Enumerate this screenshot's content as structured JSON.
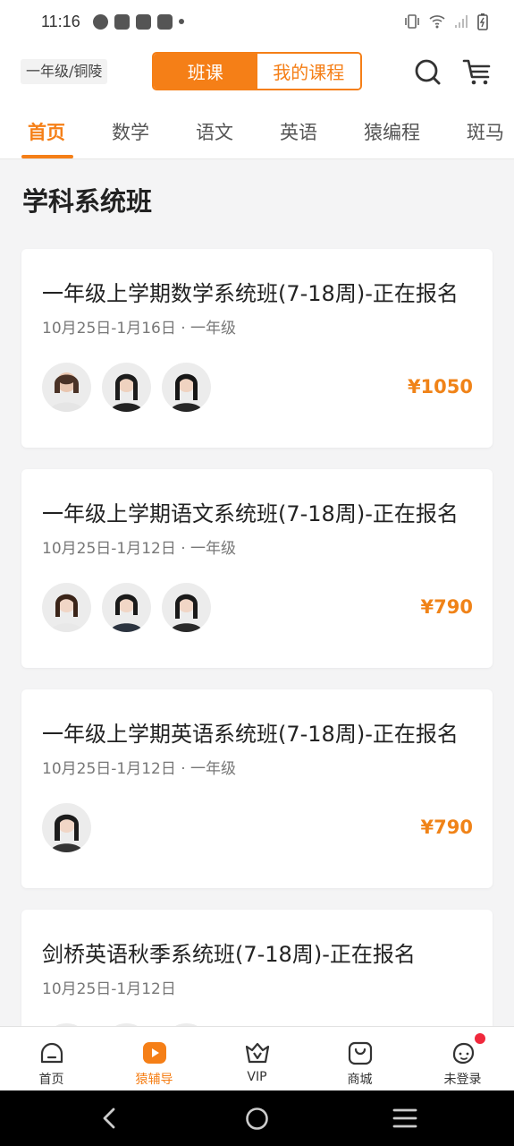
{
  "status_bar": {
    "time": "11:16"
  },
  "top_bar": {
    "grade_location": "一年级/铜陵",
    "segments": [
      "班课",
      "我的课程"
    ],
    "search_icon": "search-icon",
    "cart_icon": "cart-icon"
  },
  "tabs": [
    "首页",
    "数学",
    "语文",
    "英语",
    "猿编程",
    "斑马"
  ],
  "section_title": "学科系统班",
  "courses": [
    {
      "title": "一年级上学期数学系统班(7-18周)-正在报名",
      "meta": "10月25日-1月16日 · 一年级",
      "price": "¥1050",
      "teachers": 3
    },
    {
      "title": "一年级上学期语文系统班(7-18周)-正在报名",
      "meta": "10月25日-1月12日 · 一年级",
      "price": "¥790",
      "teachers": 3
    },
    {
      "title": "一年级上学期英语系统班(7-18周)-正在报名",
      "meta": "10月25日-1月12日 · 一年级",
      "price": "¥790",
      "teachers": 1
    },
    {
      "title": "剑桥英语秋季系统班(7-18周)-正在报名",
      "meta": "10月25日-1月12日",
      "price": "",
      "teachers": 3
    }
  ],
  "bottom_nav": [
    {
      "label": "首页",
      "icon": "home-icon"
    },
    {
      "label": "猿辅导",
      "icon": "play-icon"
    },
    {
      "label": "VIP",
      "icon": "vip-icon"
    },
    {
      "label": "商城",
      "icon": "bag-icon"
    },
    {
      "label": "未登录",
      "icon": "user-icon"
    }
  ],
  "colors": {
    "accent": "#f57f17",
    "price": "#f08318",
    "badge": "#f0283c"
  }
}
